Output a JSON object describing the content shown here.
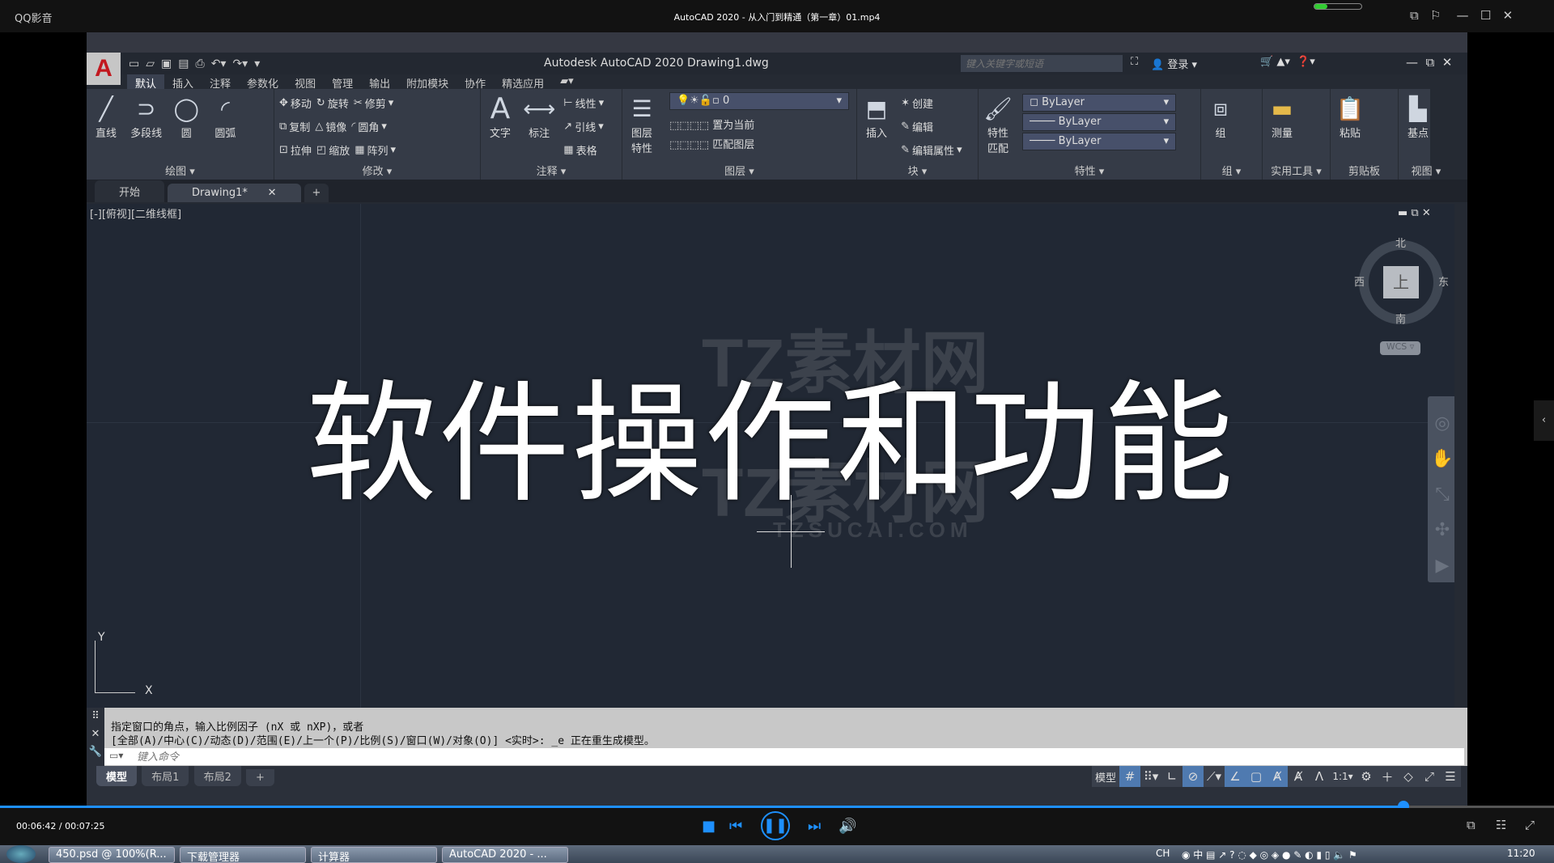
{
  "player": {
    "app": "QQ影音",
    "title": "AutoCAD 2020 - 从入门到精通（第一章）01.mp4",
    "time": "00:06:42 / 00:07:25",
    "progress": 0.903
  },
  "acad": {
    "window_title": "Autodesk AutoCAD 2020    Drawing1.dwg",
    "search_placeholder": "键入关键字或短语",
    "login": "登录",
    "menu_tabs": [
      "默认",
      "插入",
      "注释",
      "参数化",
      "视图",
      "管理",
      "输出",
      "附加模块",
      "协作",
      "精选应用"
    ],
    "ribbon": {
      "draw": {
        "label": "绘图",
        "tools": [
          "直线",
          "多段线",
          "圆",
          "圆弧"
        ]
      },
      "modify": {
        "label": "修改",
        "tools": [
          "移动",
          "旋转",
          "修剪",
          "复制",
          "镜像",
          "圆角",
          "拉伸",
          "缩放",
          "阵列"
        ]
      },
      "annotate": {
        "label": "注释",
        "tools": [
          "文字",
          "标注",
          "线性",
          "引线",
          "表格"
        ]
      },
      "layers": {
        "label": "图层",
        "tools": [
          "图层特性",
          "置为当前",
          "匹配图层"
        ],
        "current_layer": "0"
      },
      "block": {
        "label": "块",
        "tools": [
          "插入",
          "创建",
          "编辑",
          "编辑属性"
        ]
      },
      "properties": {
        "label": "特性",
        "tools": [
          "特性匹配"
        ],
        "color": "ByLayer",
        "linetype": "ByLayer",
        "lineweight": "ByLayer"
      },
      "groups": {
        "label": "组",
        "tools": [
          "组"
        ]
      },
      "utilities": {
        "label": "实用工具",
        "tools": [
          "测量"
        ]
      },
      "clipboard": {
        "label": "剪贴板",
        "tools": [
          "粘贴"
        ]
      },
      "view": {
        "label": "视图",
        "tools": [
          "基点"
        ]
      }
    },
    "file_tabs": [
      "开始",
      "Drawing1*"
    ],
    "viewport_label": "[-][俯视][二维线框]",
    "viewcube": {
      "north": "北",
      "south": "南",
      "east": "东",
      "west": "西",
      "face": "上",
      "wcs": "WCS"
    },
    "overlay_text": "软件操作和功能",
    "watermark": {
      "text": "TZ素材网",
      "url": "TZSUCAI.COM"
    },
    "command_history": [
      "指定窗口的角点，输入比例因子 (nX 或 nXP)，或者",
      "[全部(A)/中心(C)/动态(D)/范围(E)/上一个(P)/比例(S)/窗口(W)/对象(O)] <实时>: _e 正在重生成模型。"
    ],
    "command_placeholder": "键入命令",
    "layout_tabs": [
      "模型",
      "布局1",
      "布局2"
    ],
    "status": {
      "model": "模型",
      "scale": "1:1"
    }
  },
  "taskbar": {
    "items": [
      "450.psd @ 100%(R...",
      "下载管理器",
      "计算器",
      "AutoCAD 2020 - ..."
    ],
    "lang": "CH",
    "clock": "11:20"
  }
}
